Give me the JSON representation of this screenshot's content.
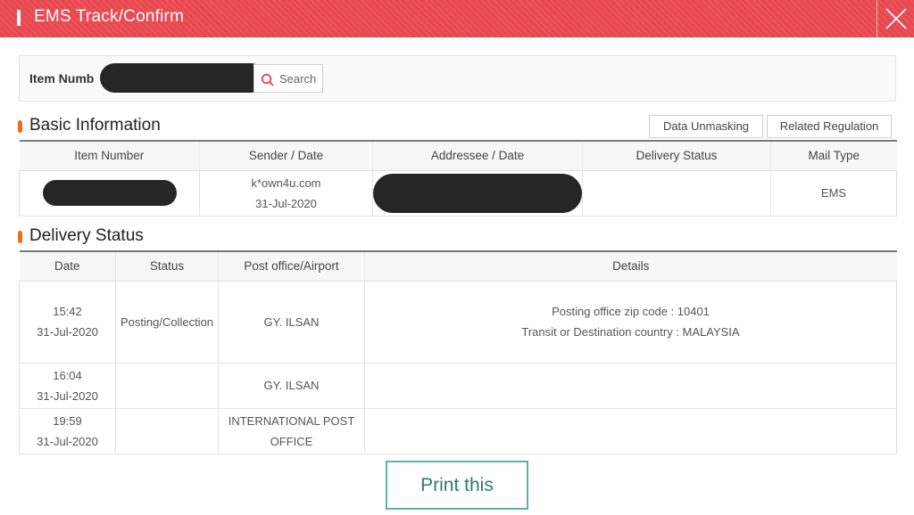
{
  "window": {
    "title": "EMS Track/Confirm",
    "accent_color": "#e8474f"
  },
  "search": {
    "label": "Item Numb",
    "button_label": "Search"
  },
  "basic_info": {
    "heading": "Basic Information",
    "buttons": [
      "Data Unmasking",
      "Related Regulation"
    ],
    "columns": [
      "Item Number",
      "Sender / Date",
      "Addressee / Date",
      "Delivery Status",
      "Mail Type"
    ],
    "row": {
      "sender": "k*own4u.com",
      "sender_date": "31-Jul-2020",
      "delivery_status": "",
      "mail_type": "EMS"
    }
  },
  "delivery": {
    "heading": "Delivery Status",
    "columns": [
      "Date",
      "Status",
      "Post office/Airport",
      "Details"
    ],
    "rows": [
      {
        "time": "15:42",
        "date": "31-Jul-2020",
        "status": "Posting/Collection",
        "office_line1": "GY. ILSAN",
        "office_line2": "",
        "details_line1": "Posting office zip code : 10401",
        "details_line2": "Transit or Destination country : MALAYSIA"
      },
      {
        "time": "16:04",
        "date": "31-Jul-2020",
        "status": "",
        "office_line1": "GY. ILSAN",
        "office_line2": "",
        "details_line1": "",
        "details_line2": ""
      },
      {
        "time": "19:59",
        "date": "31-Jul-2020",
        "status": "",
        "office_line1": "INTERNATIONAL POST",
        "office_line2": "OFFICE",
        "details_line1": "",
        "details_line2": ""
      }
    ]
  },
  "footer": {
    "print_label": "Print this"
  }
}
